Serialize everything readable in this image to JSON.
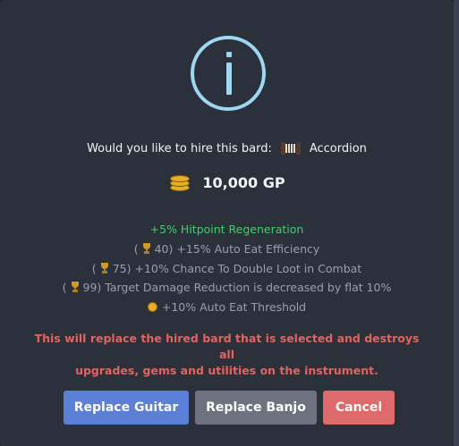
{
  "dialog": {
    "question_prefix": "Would you like to hire this bard:",
    "bard_name": "Accordion",
    "bard_icon": "accordion-icon",
    "cost": "10,000 GP",
    "cost_icon": "gp-coins-icon",
    "info_icon": "info-icon",
    "info_color": "#9bd8f2"
  },
  "stats": {
    "primary": "+5% Hitpoint Regeneration",
    "mastery": [
      {
        "icon": "trophy-icon",
        "level": "40)",
        "text": "+15% Auto Eat Efficiency"
      },
      {
        "icon": "trophy-icon",
        "level": "75)",
        "text": "+10% Chance To Double Loot in Combat"
      },
      {
        "icon": "trophy-icon",
        "level": "99)",
        "text": "Target Damage Reduction is decreased by flat 10%"
      }
    ],
    "gp_bonus": "+10% Auto Eat Threshold"
  },
  "warning": {
    "line1": "This will replace the hired bard that is selected and destroys all",
    "line2": "upgrades, gems and utilities on the instrument."
  },
  "buttons": {
    "replace_guitar": "Replace Guitar",
    "replace_banjo": "Replace Banjo",
    "cancel": "Cancel"
  },
  "colors": {
    "background": "#2b313b",
    "positive": "#3fcf6e",
    "warning": "#e4635f",
    "primary_button": "#5a7fd6",
    "secondary_button": "#6c737f",
    "danger_button": "#de6a6a"
  }
}
